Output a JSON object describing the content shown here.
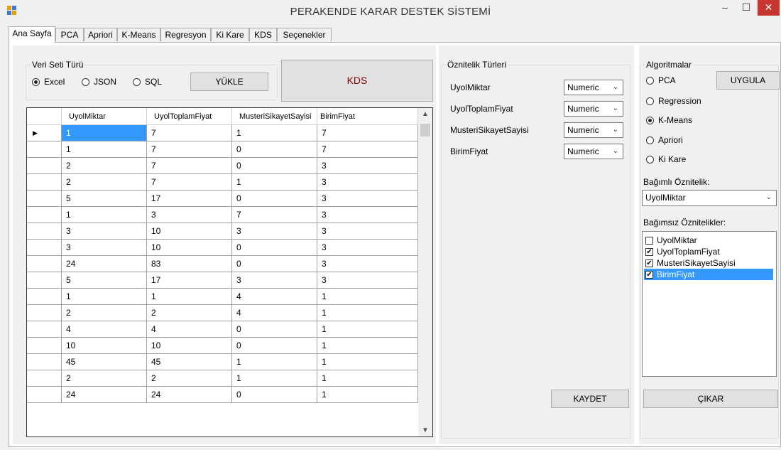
{
  "window": {
    "title": "PERAKENDE KARAR DESTEK SİSTEMİ"
  },
  "tabs": [
    "Ana Sayfa",
    "PCA",
    "Apriori",
    "K-Means",
    "Regresyon",
    "Ki Kare",
    "KDS",
    "Seçenekler"
  ],
  "dataset_group": {
    "title": "Veri Seti Türü",
    "options": [
      {
        "label": "Excel",
        "selected": true
      },
      {
        "label": "JSON",
        "selected": false
      },
      {
        "label": "SQL",
        "selected": false
      }
    ],
    "load_button": "YÜKLE"
  },
  "kds_button": "KDS",
  "grid": {
    "columns": [
      "UyolMiktar",
      "UyolToplamFiyat",
      "MusteriSikayetSayisi",
      "BirimFiyat"
    ],
    "rows": [
      [
        "1",
        "7",
        "1",
        "7"
      ],
      [
        "1",
        "7",
        "0",
        "7"
      ],
      [
        "2",
        "7",
        "0",
        "3"
      ],
      [
        "2",
        "7",
        "1",
        "3"
      ],
      [
        "5",
        "17",
        "0",
        "3"
      ],
      [
        "1",
        "3",
        "7",
        "3"
      ],
      [
        "3",
        "10",
        "3",
        "3"
      ],
      [
        "3",
        "10",
        "0",
        "3"
      ],
      [
        "24",
        "83",
        "0",
        "3"
      ],
      [
        "5",
        "17",
        "3",
        "3"
      ],
      [
        "1",
        "1",
        "4",
        "1"
      ],
      [
        "2",
        "2",
        "4",
        "1"
      ],
      [
        "4",
        "4",
        "0",
        "1"
      ],
      [
        "10",
        "10",
        "0",
        "1"
      ],
      [
        "45",
        "45",
        "1",
        "1"
      ],
      [
        "2",
        "2",
        "1",
        "1"
      ],
      [
        "24",
        "24",
        "0",
        "1"
      ]
    ],
    "current_row_marker": "▶"
  },
  "attribute_types": {
    "title": "Öznitelik Türleri",
    "items": [
      {
        "name": "UyolMiktar",
        "type": "Numeric"
      },
      {
        "name": "UyolToplamFiyat",
        "type": "Numeric"
      },
      {
        "name": "MusteriSikayetSayisi",
        "type": "Numeric"
      },
      {
        "name": "BirimFiyat",
        "type": "Numeric"
      }
    ],
    "save_button": "KAYDET"
  },
  "algorithms": {
    "title": "Algoritmalar",
    "options": [
      {
        "label": "PCA",
        "selected": false
      },
      {
        "label": "Regression",
        "selected": false
      },
      {
        "label": "K-Means",
        "selected": true
      },
      {
        "label": "Apriori",
        "selected": false
      },
      {
        "label": "Ki Kare",
        "selected": false
      }
    ],
    "apply_button": "UYGULA",
    "dependent_label": "Bağımlı Öznitelik:",
    "dependent_value": "UyolMiktar",
    "independent_label": "Bağımsız Öznitelikler:",
    "independent_items": [
      {
        "label": "UyolMiktar",
        "checked": false,
        "selected": false
      },
      {
        "label": "UyolToplamFiyat",
        "checked": true,
        "selected": false
      },
      {
        "label": "MusteriSikayetSayisi",
        "checked": true,
        "selected": false
      },
      {
        "label": "BirimFiyat",
        "checked": true,
        "selected": true
      }
    ],
    "remove_button": "ÇIKAR"
  },
  "icons": {
    "minimize": "–",
    "maximize": "☐",
    "close": "✕",
    "chevron": "⌄",
    "scroll_up": "▲",
    "scroll_down": "▼",
    "check": "✔"
  },
  "colors": {
    "selection": "#3399ff",
    "kds_text": "#8b0000",
    "close_button": "#c7372f"
  }
}
